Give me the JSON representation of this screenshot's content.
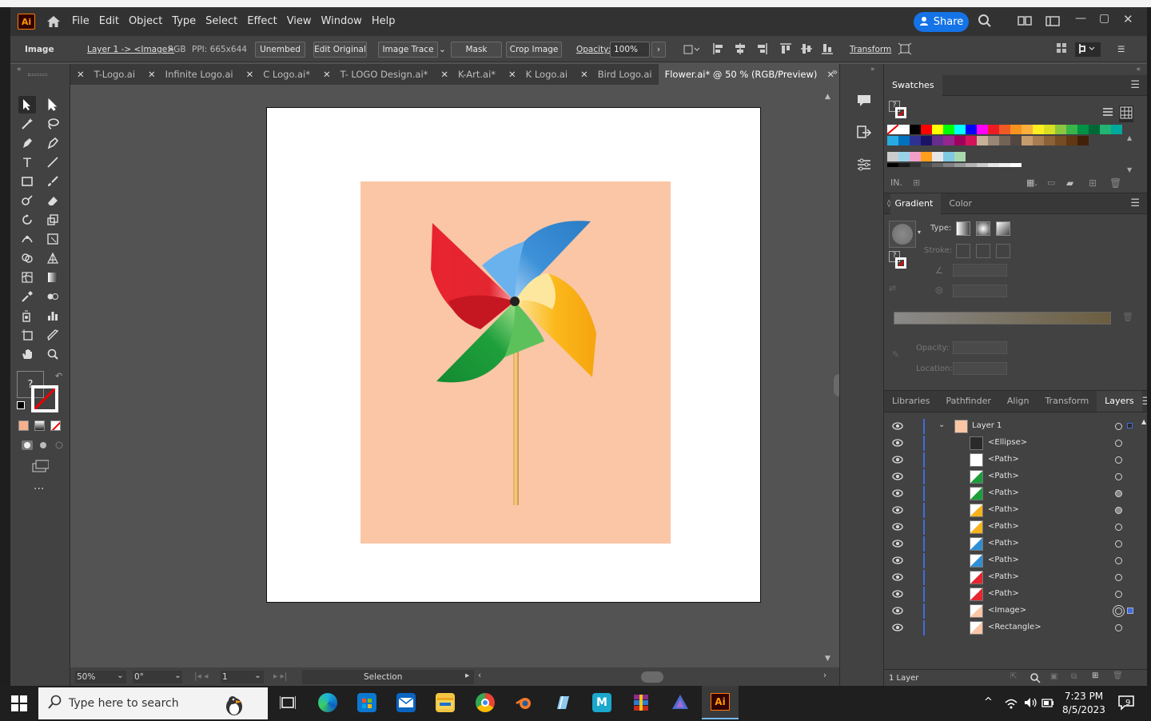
{
  "menubar": {
    "logo": "Ai",
    "items": [
      "File",
      "Edit",
      "Object",
      "Type",
      "Select",
      "Effect",
      "View",
      "Window",
      "Help"
    ],
    "share_label": "Share"
  },
  "control_bar": {
    "object_type": "Image",
    "layer_path": "Layer 1 -> <Image>",
    "color_mode": "RGB",
    "ppi": "PPI: 665x644",
    "unembed": "Unembed",
    "edit_original": "Edit Original",
    "image_trace": "Image Trace",
    "mask": "Mask",
    "crop_image": "Crop Image",
    "opacity_label": "Opacity:",
    "opacity_value": "100%",
    "transform": "Transform"
  },
  "doc_tabs": [
    {
      "label": "T-Logo.ai"
    },
    {
      "label": "Infinite Logo.ai"
    },
    {
      "label": "C Logo.ai*"
    },
    {
      "label": "T- LOGO Design.ai*"
    },
    {
      "label": "K-Art.ai*"
    },
    {
      "label": "K Logo.ai"
    },
    {
      "label": "Bird Logo.ai"
    },
    {
      "label": "Flower.ai* @ 50 % (RGB/Preview)"
    }
  ],
  "status_bar": {
    "zoom": "50%",
    "rotation": "0°",
    "artboard": "1",
    "tool": "Selection"
  },
  "swatches_panel": {
    "title": "Swatches",
    "colors": [
      "#ffffff",
      "#000000",
      "#ff0000",
      "#ffff00",
      "#00ff00",
      "#00ffff",
      "#0000ff",
      "#ff00ff",
      "#ed1c24",
      "#f15a24",
      "#f7931e",
      "#fbb03b",
      "#fcee21",
      "#d9e021",
      "#8cc63f",
      "#39b54a",
      "#009245",
      "#006837",
      "#22b573",
      "#00a99d",
      "#29abe2",
      "#0071bc",
      "#2e3192",
      "#1b1464",
      "#662d91",
      "#93278f",
      "#9e005d",
      "#d4145a",
      "#c7b299",
      "#998675",
      "#736357",
      "#534741",
      "#c69c6d",
      "#a67c52",
      "#8c6239",
      "#754c24",
      "#603813",
      "#42210b"
    ],
    "grays": [
      "#000000",
      "#1a1a1a",
      "#333333",
      "#4d4d4d",
      "#666666",
      "#808080",
      "#999999",
      "#b3b3b3",
      "#cccccc",
      "#e6e6e6",
      "#f2f2f2",
      "#ffffff"
    ]
  },
  "gradient_panel": {
    "tabs": [
      "Gradient",
      "Color"
    ],
    "type_label": "Type:",
    "stroke_label": "Stroke:",
    "opacity_label": "Opacity:",
    "location_label": "Location:"
  },
  "layers_panel": {
    "tabs": [
      "Libraries",
      "Pathfinder",
      "Align",
      "Transform",
      "Layers"
    ],
    "layer_name": "Layer 1",
    "items": [
      {
        "name": "<Ellipse>",
        "thumb": "#2a2a2a"
      },
      {
        "name": "<Path>",
        "thumb": "#ffffff"
      },
      {
        "name": "<Path>",
        "thumb": "#1b9e3a"
      },
      {
        "name": "<Path>",
        "thumb": "#1b9e3a"
      },
      {
        "name": "<Path>",
        "thumb": "#f6b21a"
      },
      {
        "name": "<Path>",
        "thumb": "#f6b21a"
      },
      {
        "name": "<Path>",
        "thumb": "#2f8fd6"
      },
      {
        "name": "<Path>",
        "thumb": "#2f8fd6"
      },
      {
        "name": "<Path>",
        "thumb": "#e52631"
      },
      {
        "name": "<Path>",
        "thumb": "#e52631"
      },
      {
        "name": "<Image>",
        "thumb": "#fac6a6"
      },
      {
        "name": "<Rectangle>",
        "thumb": "#fac6a6"
      }
    ],
    "footer": "1 Layer"
  },
  "taskbar": {
    "search_placeholder": "Type here to search",
    "time": "7:23 PM",
    "date": "8/5/2023",
    "notifications": "9"
  }
}
